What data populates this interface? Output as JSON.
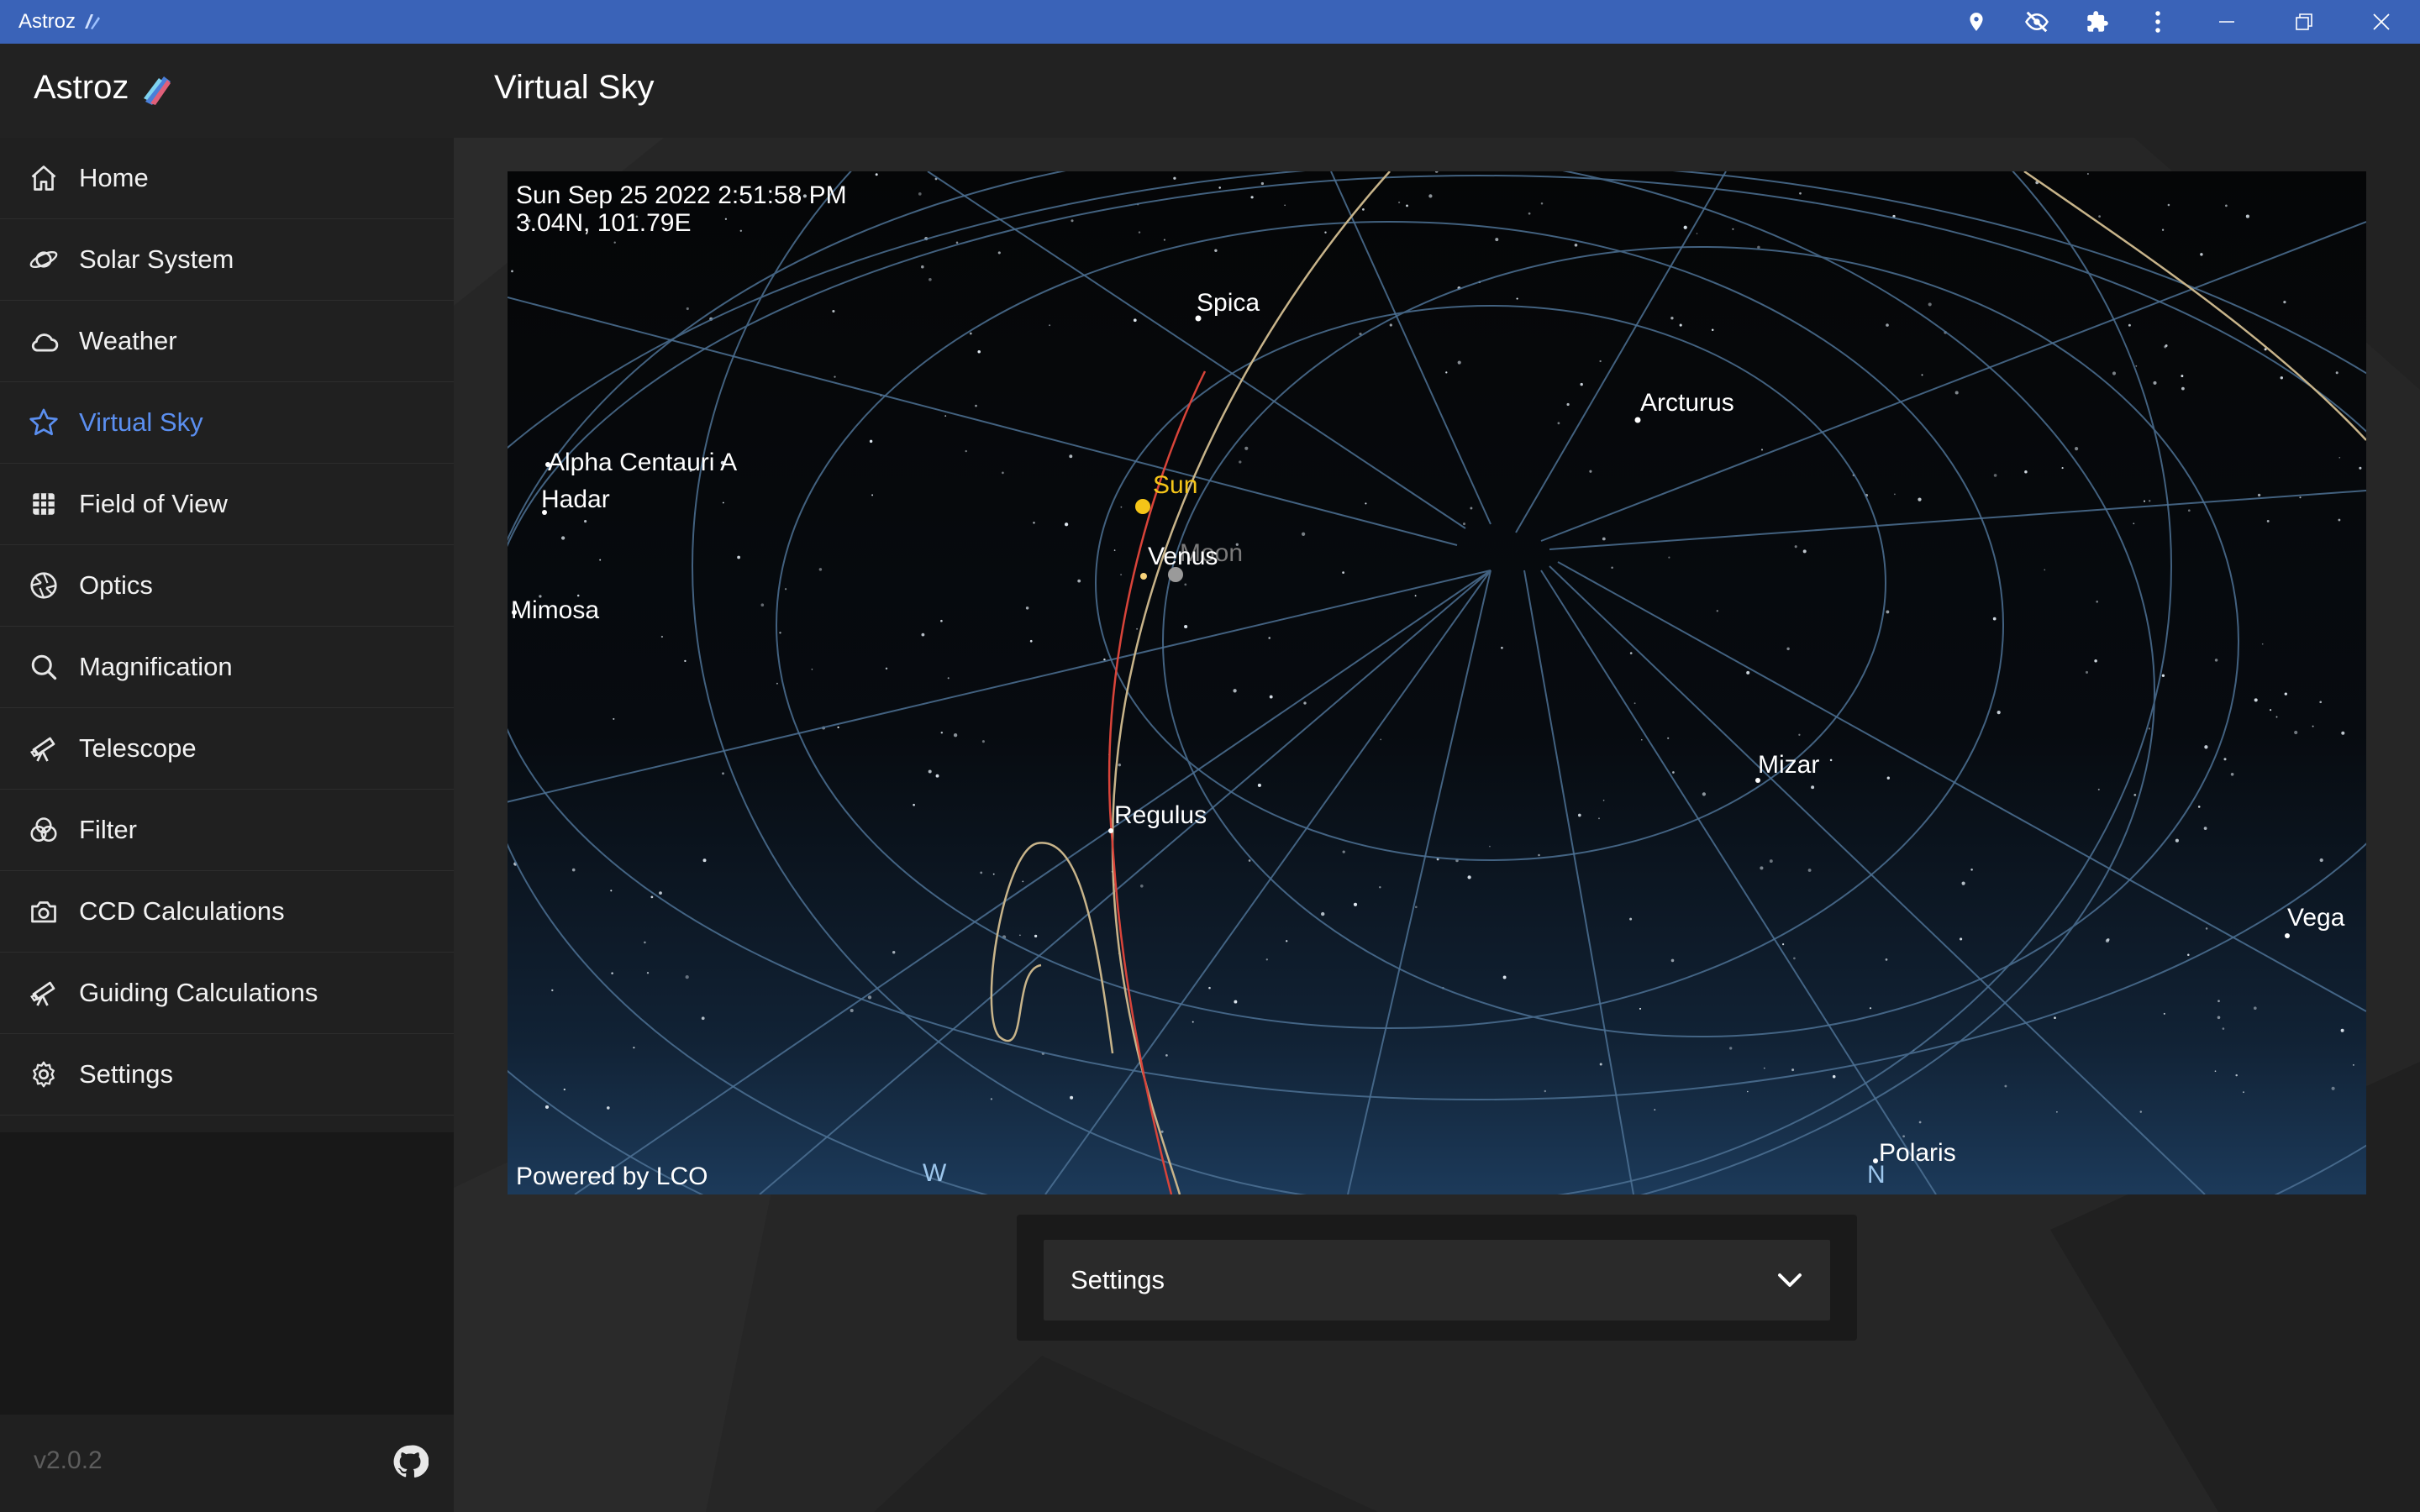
{
  "window": {
    "title": "Astroz",
    "icons": [
      "location-pin-icon",
      "eye-off-icon",
      "puzzle-icon",
      "more-vert-icon",
      "minimize-icon",
      "restore-icon",
      "close-icon"
    ]
  },
  "header": {
    "brand": "Astroz",
    "page_title": "Virtual Sky"
  },
  "sidebar": {
    "items": [
      {
        "label": "Home",
        "icon": "home-icon",
        "active": false
      },
      {
        "label": "Solar System",
        "icon": "planet-icon",
        "active": false
      },
      {
        "label": "Weather",
        "icon": "cloud-icon",
        "active": false
      },
      {
        "label": "Virtual Sky",
        "icon": "star-icon",
        "active": true
      },
      {
        "label": "Field of View",
        "icon": "grid-icon",
        "active": false
      },
      {
        "label": "Optics",
        "icon": "aperture-icon",
        "active": false
      },
      {
        "label": "Magnification",
        "icon": "search-icon",
        "active": false
      },
      {
        "label": "Telescope",
        "icon": "telescope-icon",
        "active": false
      },
      {
        "label": "Filter",
        "icon": "filter-icon",
        "active": false
      },
      {
        "label": "CCD Calculations",
        "icon": "camera-icon",
        "active": false
      },
      {
        "label": "Guiding Calculations",
        "icon": "telescope-icon",
        "active": false
      },
      {
        "label": "Settings",
        "icon": "gear-icon",
        "active": false
      }
    ],
    "version": "v2.0.2",
    "footer_icon": "github-icon"
  },
  "sky": {
    "datetime": "Sun Sep 25 2022 2:51:58 PM",
    "location": "3.04N, 101.79E",
    "credit": "Powered by LCO",
    "labels": {
      "spica": "Spica",
      "arcturus": "Arcturus",
      "alpha_centauri": "Alpha Centauri A",
      "hadar": "Hadar",
      "mimosa": "Mimosa",
      "sun": "Sun",
      "venus": "Venus",
      "moon": "Moon",
      "mizar": "Mizar",
      "regulus": "Regulus",
      "vega": "Vega",
      "polaris": "Polaris",
      "west": "W",
      "north": "N"
    },
    "colors": {
      "sun": "#f5c518",
      "ecliptic": "#c8b48a",
      "meridian": "#d9443a",
      "grid": "#4d7194"
    }
  },
  "settings_panel": {
    "label": "Settings"
  }
}
